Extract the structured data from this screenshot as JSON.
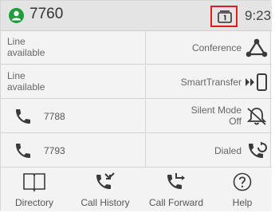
{
  "header": {
    "extension": "7760",
    "time": "9:23"
  },
  "rows": [
    {
      "left": {
        "line1": "Line",
        "line2": "available"
      },
      "right": {
        "label": "Conference",
        "icon": "conference-icon"
      }
    },
    {
      "left": {
        "line1": "Line",
        "line2": "available"
      },
      "right": {
        "label": "SmartTransfer",
        "icon": "smart-transfer-icon"
      }
    },
    {
      "left": {
        "number": "7788",
        "icon": "phone-icon"
      },
      "right": {
        "line1": "Silent Mode",
        "line2": "Off",
        "icon": "bell-off-icon"
      }
    },
    {
      "left": {
        "number": "7793",
        "icon": "phone-icon"
      },
      "right": {
        "label": "Dialed",
        "icon": "dialed-call-icon"
      }
    }
  ],
  "softkeys": [
    {
      "label": "Directory",
      "icon": "book-icon"
    },
    {
      "label": "Call History",
      "icon": "call-history-icon"
    },
    {
      "label": "Call Forward",
      "icon": "call-forward-icon"
    },
    {
      "label": "Help",
      "icon": "help-icon"
    }
  ],
  "colors": {
    "accent_green": "#1e9e3c",
    "highlight_red": "#e01b24",
    "icon_dark": "#3a3a3a"
  }
}
